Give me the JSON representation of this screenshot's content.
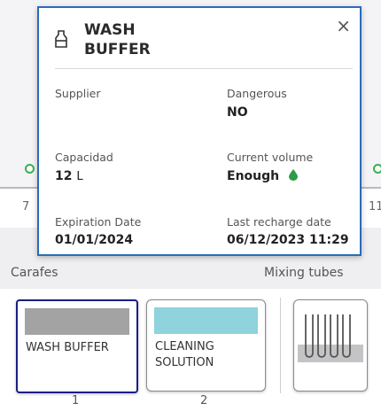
{
  "popup": {
    "title_line1": "WASH",
    "title_line2": "BUFFER",
    "close_label": "×",
    "fields": {
      "supplier": {
        "label": "Supplier",
        "value": ""
      },
      "dangerous": {
        "label": "Dangerous",
        "value": "NO"
      },
      "capacity": {
        "label": "Capacidad",
        "value": "12",
        "unit": "L"
      },
      "current_volume": {
        "label": "Current volume",
        "value": "Enough"
      },
      "expiration": {
        "label": "Expiration Date",
        "value": "01/01/2024"
      },
      "last_recharge": {
        "label": "Last recharge date",
        "value": "06/12/2023 11:29"
      }
    }
  },
  "background_positions": {
    "left": "7",
    "right": "11"
  },
  "sections": {
    "carafes": "Carafes",
    "mixing_tubes": "Mixing tubes"
  },
  "slots": [
    {
      "number": "1",
      "name": "WASH BUFFER",
      "color": "#a3a3a3"
    },
    {
      "number": "2",
      "name_line1": "CLEANING",
      "name_line2": "SOLUTION",
      "color": "#8fd3dc"
    }
  ],
  "colors": {
    "accent": "#2a6cb8",
    "selected_border": "#1a1f86",
    "drop_icon": "#2e9b4a",
    "status_dot": "#3bb04f"
  }
}
